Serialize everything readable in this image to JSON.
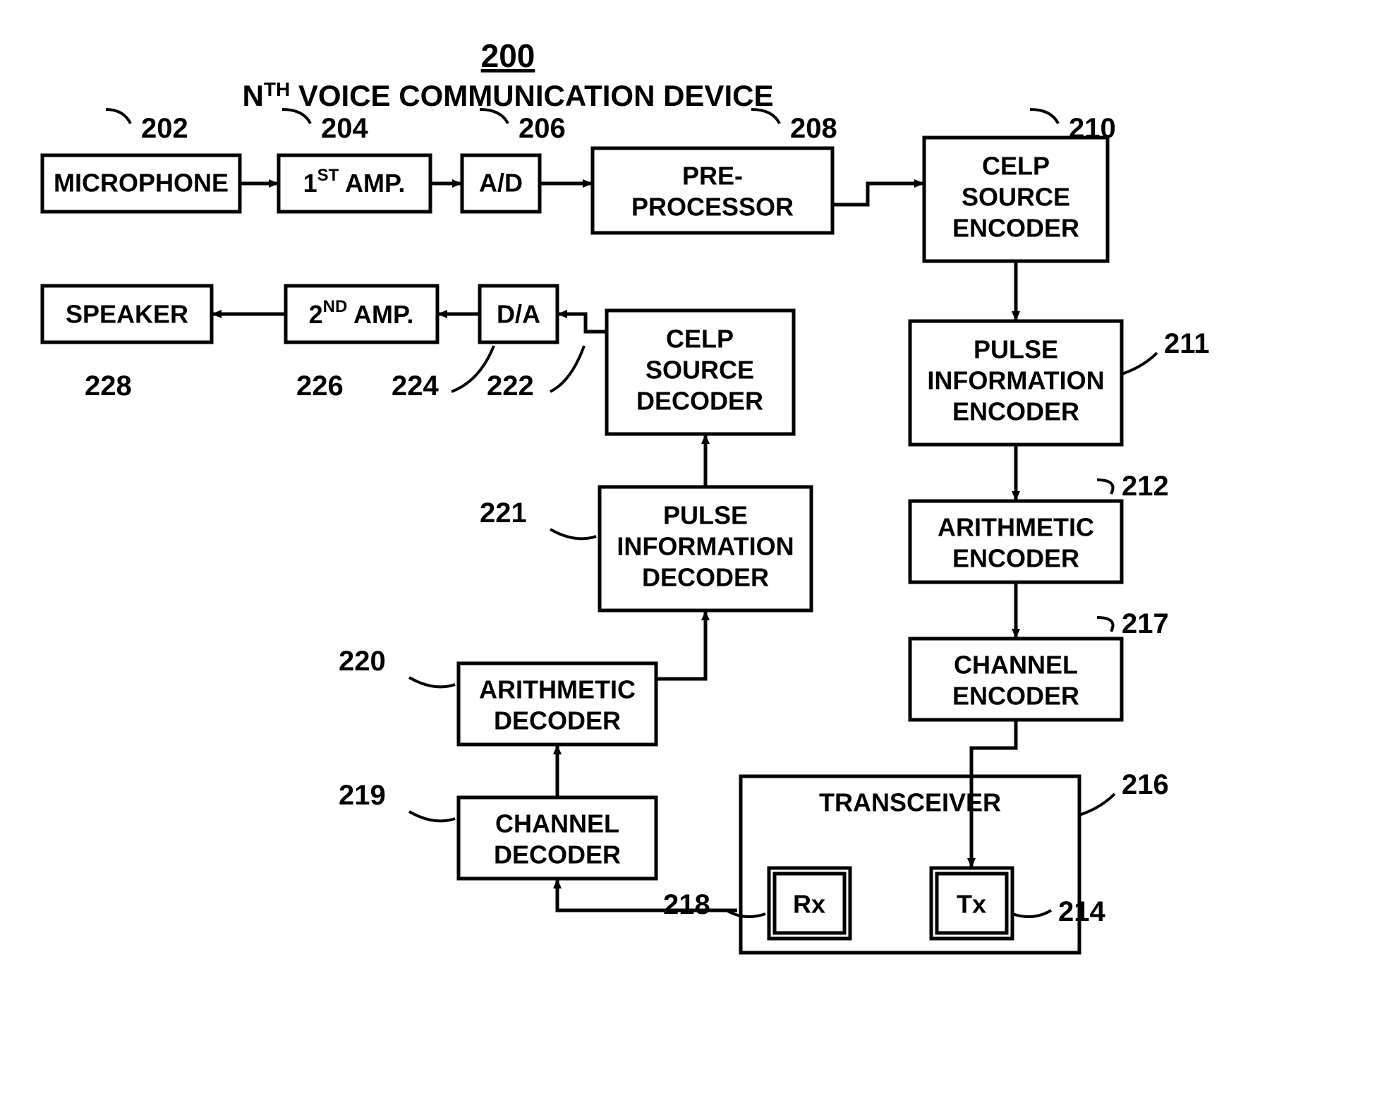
{
  "title_num": "200",
  "title_pre": "N",
  "title_sup": "TH",
  "title_rest": " VOICE COMMUNICATION DEVICE",
  "blocks": {
    "mic": {
      "label": "MICROPHONE",
      "ref": "202"
    },
    "amp1": {
      "label_pre": "1",
      "label_sup": "ST",
      "label_rest": " AMP.",
      "ref": "204"
    },
    "ad": {
      "label": "A/D",
      "ref": "206"
    },
    "pre": {
      "l1": "PRE-",
      "l2": "PROCESSOR",
      "ref": "208"
    },
    "celp_enc": {
      "l1": "CELP",
      "l2": "SOURCE",
      "l3": "ENCODER",
      "ref": "210"
    },
    "pie": {
      "l1": "PULSE",
      "l2": "INFORMATION",
      "l3": "ENCODER",
      "ref": "211"
    },
    "ae": {
      "l1": "ARITHMETIC",
      "l2": "ENCODER",
      "ref": "212"
    },
    "ce": {
      "l1": "CHANNEL",
      "l2": "ENCODER",
      "ref": "217"
    },
    "trans": {
      "label": "TRANSCEIVER",
      "ref": "216"
    },
    "tx": {
      "label": "Tx",
      "ref": "214"
    },
    "rx": {
      "label": "Rx",
      "ref": "218"
    },
    "cd": {
      "l1": "CHANNEL",
      "l2": "DECODER",
      "ref": "219"
    },
    "ad_dec": {
      "l1": "ARITHMETIC",
      "l2": "DECODER",
      "ref": "220"
    },
    "pid": {
      "l1": "PULSE",
      "l2": "INFORMATION",
      "l3": "DECODER",
      "ref": "221"
    },
    "celp_dec": {
      "l1": "CELP",
      "l2": "SOURCE",
      "l3": "DECODER",
      "ref": "222"
    },
    "da": {
      "label": "D/A",
      "ref": "224"
    },
    "amp2": {
      "label_pre": "2",
      "label_sup": "ND",
      "label_rest": " AMP.",
      "ref": "226"
    },
    "spk": {
      "label": "SPEAKER",
      "ref": "228"
    }
  }
}
